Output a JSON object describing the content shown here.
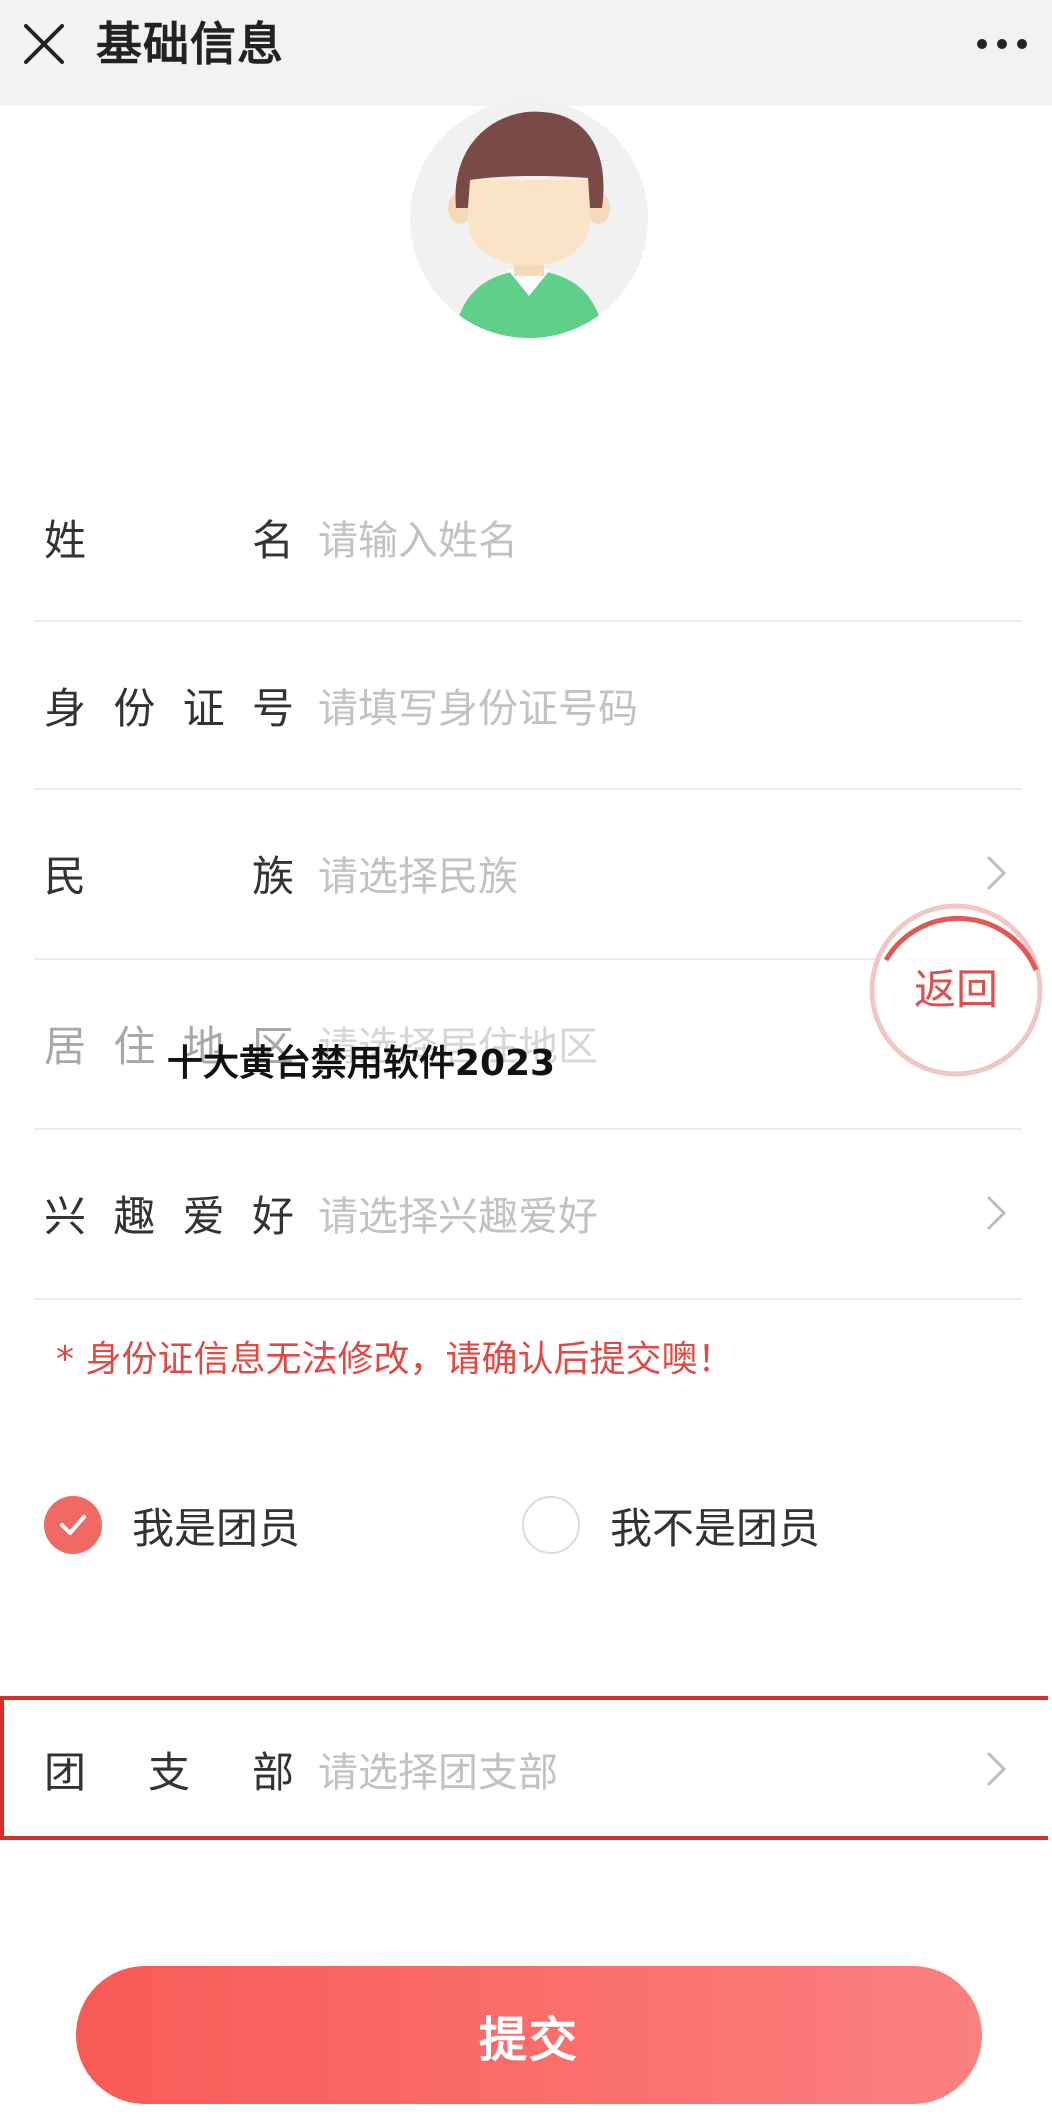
{
  "header": {
    "title": "基础信息",
    "close_icon": "close-icon",
    "more_icon": "more-dots-icon"
  },
  "avatar": {
    "icon": "default-male-avatar"
  },
  "form": {
    "name": {
      "label_chars": [
        "姓",
        "名"
      ],
      "placeholder": "请输入姓名"
    },
    "id_number": {
      "label_chars": [
        "身",
        "份",
        "证",
        "号"
      ],
      "placeholder": "请填写身份证号码"
    },
    "ethnicity": {
      "label_chars": [
        "民",
        "族"
      ],
      "placeholder": "请选择民族"
    },
    "region": {
      "label_chars": [
        "居",
        "住",
        "地",
        "区"
      ],
      "placeholder": "请选择居住地区"
    },
    "hobbies": {
      "label_chars": [
        "兴",
        "趣",
        "爱",
        "好"
      ],
      "placeholder": "请选择兴趣爱好"
    },
    "branch": {
      "label_chars": [
        "团",
        "支",
        "部"
      ],
      "placeholder": "请选择团支部"
    }
  },
  "return_button": {
    "label": "返回"
  },
  "overlay_text": "十大黄台禁用软件2023",
  "warning": "* 身份证信息无法修改，请确认后提交噢！",
  "membership": {
    "options": [
      {
        "label": "我是团员",
        "checked": true
      },
      {
        "label": "我不是团员",
        "checked": false
      }
    ]
  },
  "submit": {
    "label": "提交"
  },
  "colors": {
    "accent": "#f85a56",
    "warning": "#e04a45",
    "highlight_frame": "#d62f2a",
    "avatar_hair": "#7a4b46",
    "avatar_shirt": "#5fcf8a"
  }
}
